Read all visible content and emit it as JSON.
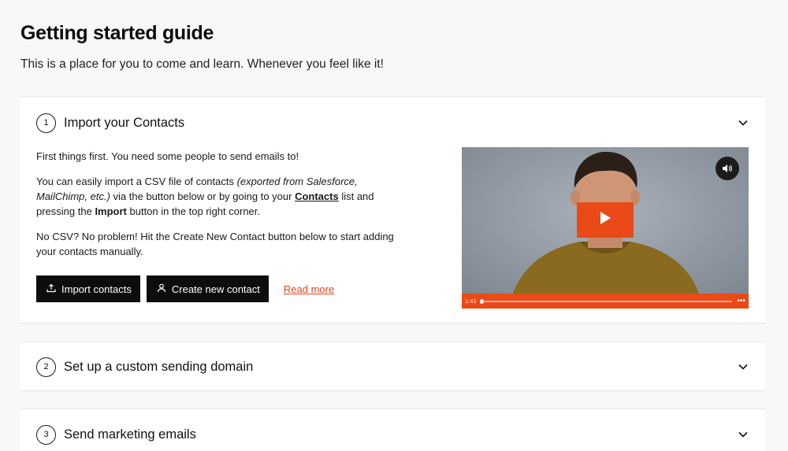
{
  "page": {
    "title": "Getting started guide",
    "subtitle": "This is a place for you to come and learn. Whenever you feel like it!"
  },
  "steps": [
    {
      "number": "1",
      "title": "Import your Contacts",
      "expanded": true,
      "body": {
        "p1": "First things first. You need some people to send emails to!",
        "p2_a": "You can easily import a CSV file of contacts ",
        "p2_em": "(exported from Salesforce, MailChimp, etc.)",
        "p2_b": " via the button below or by going to your ",
        "p2_link": "Contacts",
        "p2_c": " list and pressing the ",
        "p2_bold": "Import",
        "p2_d": " button in the top right corner.",
        "p3": "No CSV? No problem! Hit the Create New Contact button below to start adding your contacts manually."
      },
      "buttons": {
        "import_label": "Import contacts",
        "create_label": "Create new contact",
        "read_more_label": "Read more"
      },
      "video": {
        "time": "1:43",
        "progress": 0.0
      }
    },
    {
      "number": "2",
      "title": "Set up a custom sending domain",
      "expanded": false
    },
    {
      "number": "3",
      "title": "Send marketing emails",
      "expanded": false
    }
  ],
  "colors": {
    "accent": "#ea4a17",
    "button_bg": "#0d0d0d",
    "page_bg": "#f7f8fa"
  },
  "icons": {
    "chevron": "chevron-down-icon",
    "upload": "upload-icon",
    "user": "user-icon",
    "volume": "volume-icon",
    "play": "play-icon",
    "more": "more-dots-icon"
  }
}
